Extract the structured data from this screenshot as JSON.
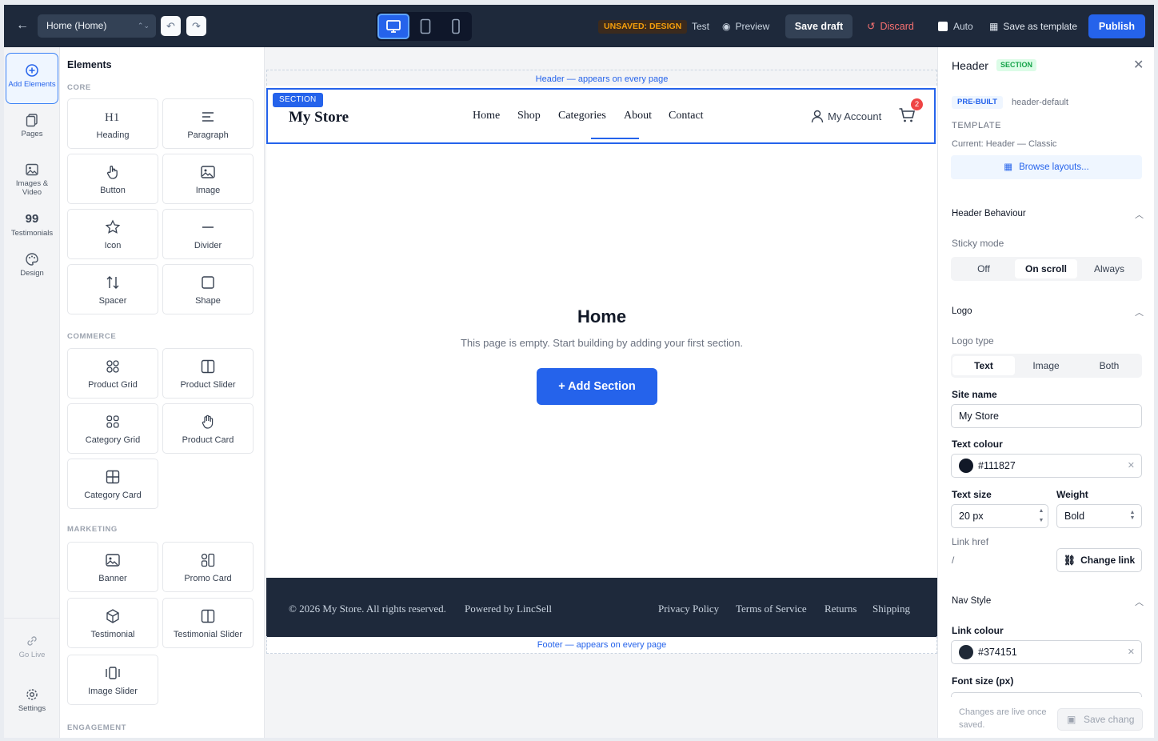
{
  "topbar": {
    "page_select": "Home (Home)",
    "status_badge": "UNSAVED: DESIGN",
    "test": "Test",
    "preview": "Preview",
    "save_draft": "Save draft",
    "discard": "Discard",
    "auto": "Auto",
    "save_template": "Save as template",
    "publish": "Publish"
  },
  "rail": {
    "add": "Add Elements",
    "pages": "Pages",
    "images": "Images & Video",
    "testimonials_glyph": "99",
    "testimonials": "Testimonials",
    "design": "Design",
    "go_live": "Go Live",
    "settings": "Settings"
  },
  "panel": {
    "title": "Elements",
    "core": "CORE",
    "commerce": "COMMERCE",
    "marketing": "MARKETING",
    "engagement": "ENGAGEMENT",
    "tiles": {
      "heading": "Heading",
      "paragraph": "Paragraph",
      "button": "Button",
      "image": "Image",
      "icon": "Icon",
      "divider": "Divider",
      "spacer": "Spacer",
      "shape": "Shape",
      "product_grid": "Product Grid",
      "product_slider": "Product Slider",
      "category_grid": "Category Grid",
      "product_card": "Product Card",
      "category_card": "Category Card",
      "banner": "Banner",
      "promo_card": "Promo Card",
      "testimonial": "Testimonial",
      "testimonial_slider": "Testimonial Slider",
      "image_slider": "Image Slider"
    }
  },
  "canvas": {
    "header_hint": "Header — appears on every page",
    "footer_hint": "Footer — appears on every page",
    "section_tag": "SECTION",
    "logo": "My Store",
    "nav": [
      "Home",
      "Shop",
      "Categories",
      "About",
      "Contact"
    ],
    "account": "My Account",
    "cart_count": "2",
    "empty_title": "Home",
    "empty_sub": "This page is empty. Start building by adding your first section.",
    "add_section": "+ Add Section",
    "footer": {
      "copyright": "© 2026 My Store. All rights reserved.",
      "powered": "Powered by LincSell",
      "links": [
        "Privacy Policy",
        "Terms of Service",
        "Returns",
        "Shipping"
      ]
    }
  },
  "inspector": {
    "title": "Header",
    "badge": "SECTION",
    "prebuilt": "PRE-BUILT",
    "prebuilt_id": "header-default",
    "template_label": "TEMPLATE",
    "template_current": "Current: Header — Classic",
    "browse": "Browse layouts...",
    "behaviour_head": "Header Behaviour",
    "sticky_label": "Sticky mode",
    "sticky_options": [
      "Off",
      "On scroll",
      "Always"
    ],
    "sticky_selected": "On scroll",
    "logo_head": "Logo",
    "logo_type_label": "Logo type",
    "logo_type_options": [
      "Text",
      "Image",
      "Both"
    ],
    "logo_type_selected": "Text",
    "site_name_label": "Site name",
    "site_name_value": "My Store",
    "text_colour_label": "Text colour",
    "text_colour_value": "#111827",
    "text_size_label": "Text size",
    "text_size_value": "20 px",
    "weight_label": "Weight",
    "weight_value": "Bold",
    "link_href_label": "Link href",
    "link_href_value": "/",
    "change_link": "Change link",
    "nav_style_head": "Nav Style",
    "link_colour_label": "Link colour",
    "link_colour_value": "#374151",
    "font_size_label": "Font size (px)",
    "footnote": "Changes are live once saved.",
    "save_button": "Save chang"
  },
  "colors": {
    "accent": "#2563eb",
    "topbar_bg": "#1e293b",
    "warning": "#f59e0b",
    "danger": "#f87171",
    "success": "#16a34a"
  }
}
